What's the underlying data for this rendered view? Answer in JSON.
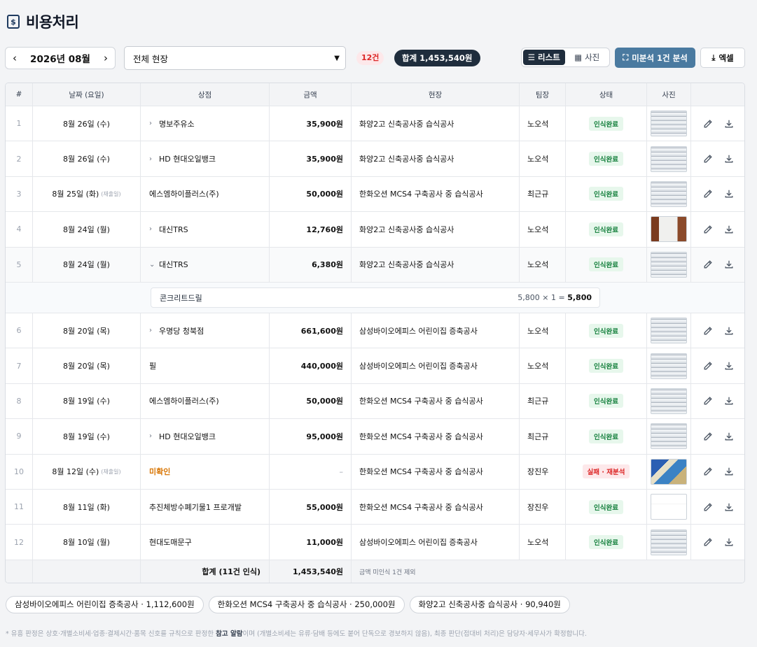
{
  "page": {
    "title": "비용처리",
    "title_icon": "receipt-dollar-icon"
  },
  "toolbar": {
    "prev_icon": "‹",
    "next_icon": "›",
    "month_label": "2026년 08월",
    "site_filter": "전체 현장",
    "count_badge": "12건",
    "total_badge": "합계 1,453,540원",
    "view_list_label": "리스트",
    "view_photo_label": "사진",
    "analyze_label": "미분석 1건 분석",
    "excel_label": "엑셀"
  },
  "table": {
    "headers": {
      "no": "#",
      "date": "날짜 (요일)",
      "store": "상점",
      "amount": "금액",
      "site": "현장",
      "lead": "팀장",
      "status": "상태",
      "photo": "사진"
    },
    "rows": [
      {
        "no": "1",
        "date": "8월 26일 (수)",
        "sub": "",
        "expand": "›",
        "store": "명보주유소",
        "amount": "35,900원",
        "site": "화양2고 신축공사중 습식공사",
        "lead": "노오석",
        "status": "인식완료",
        "status_type": "ok"
      },
      {
        "no": "2",
        "date": "8월 26일 (수)",
        "sub": "",
        "expand": "›",
        "store": "HD 현대오일뱅크",
        "amount": "35,900원",
        "site": "화양2고 신축공사중 습식공사",
        "lead": "노오석",
        "status": "인식완료",
        "status_type": "ok"
      },
      {
        "no": "3",
        "date": "8월 25일 (화)",
        "sub": "(재출일)",
        "expand": "",
        "store": "에스엠하이플러스(주)",
        "amount": "50,000원",
        "site": "한화오션 MCS4 구축공사 중 습식공사",
        "lead": "최근규",
        "status": "인식완료",
        "status_type": "ok"
      },
      {
        "no": "4",
        "date": "8월 24일 (월)",
        "sub": "",
        "expand": "›",
        "store": "대신TRS",
        "amount": "12,760원",
        "site": "화양2고 신축공사중 습식공사",
        "lead": "노오석",
        "status": "인식완료",
        "status_type": "ok"
      },
      {
        "no": "5",
        "date": "8월 24일 (월)",
        "sub": "",
        "expand": "⌄",
        "store": "대신TRS",
        "amount": "6,380원",
        "site": "화양2고 신축공사중 습식공사",
        "lead": "노오석",
        "status": "인식완료",
        "status_type": "ok"
      },
      {
        "no": "6",
        "date": "8월 20일 (목)",
        "sub": "",
        "expand": "›",
        "store": "우명당 청북점",
        "amount": "661,600원",
        "site": "삼성바이오에피스 어린이집 증축공사",
        "lead": "노오석",
        "status": "인식완료",
        "status_type": "ok"
      },
      {
        "no": "7",
        "date": "8월 20일 (목)",
        "sub": "",
        "expand": "",
        "store": "필",
        "amount": "440,000원",
        "site": "삼성바이오에피스 어린이집 증축공사",
        "lead": "노오석",
        "status": "인식완료",
        "status_type": "ok"
      },
      {
        "no": "8",
        "date": "8월 19일 (수)",
        "sub": "",
        "expand": "",
        "store": "에스엠하이플러스(주)",
        "amount": "50,000원",
        "site": "한화오션 MCS4 구축공사 중 습식공사",
        "lead": "최근규",
        "status": "인식완료",
        "status_type": "ok"
      },
      {
        "no": "9",
        "date": "8월 19일 (수)",
        "sub": "",
        "expand": "›",
        "store": "HD 현대오일뱅크",
        "amount": "95,000원",
        "site": "한화오션 MCS4 구축공사 중 습식공사",
        "lead": "최근규",
        "status": "인식완료",
        "status_type": "ok"
      },
      {
        "no": "10",
        "date": "8월 12일 (수)",
        "sub": "(재출일)",
        "expand": "",
        "store": "미확인",
        "amount": "–",
        "site": "한화오션 MCS4 구축공사 중 습식공사",
        "lead": "장진우",
        "status": "실패 · 재분석",
        "status_type": "fail"
      },
      {
        "no": "11",
        "date": "8월 11일 (화)",
        "sub": "",
        "expand": "",
        "store": "추진체방수폐기물1 프로개발",
        "amount": "55,000원",
        "site": "한화오션 MCS4 구축공사 중 습식공사",
        "lead": "장진우",
        "status": "인식완료",
        "status_type": "ok"
      },
      {
        "no": "12",
        "date": "8월 10일 (월)",
        "sub": "",
        "expand": "",
        "store": "현대도매문구",
        "amount": "11,000원",
        "site": "삼성바이오에피스 어린이집 증축공사",
        "lead": "노오석",
        "status": "인식완료",
        "status_type": "ok"
      }
    ],
    "detail": {
      "item": "콘크리트드릴",
      "calc": "5,800 × 1 = ",
      "result": "5,800"
    },
    "total": {
      "label": "합계 (11건 인식)",
      "amount": "1,453,540원",
      "note": "금액 미인식 1건 제외"
    }
  },
  "summary_chips": [
    "삼성바이오에피스 어린이집 증축공사 · 1,112,600원",
    "한화오션 MCS4 구축공사 중 습식공사 · 250,000원",
    "화양2고 신축공사중 습식공사 · 90,940원"
  ],
  "footnote": {
    "prefix": "* 유흥 판정은 상호·개별소비세·업종·결제시간·품목 신호를 규칙으로 판정한 ",
    "bold": "참고 알람",
    "suffix": "이며 (개별소비세는 유류·담배 등에도 붙어 단독으로 경보하지 않음), 최종 판단(접대비 처리)은 담당자·세무사가 확정합니다."
  },
  "colors": {
    "dark": "#1f2d3d",
    "accent": "#4a7aa0",
    "ok_bg": "#e7f7ec",
    "ok_text": "#15803d",
    "fail_bg": "#fde8ea",
    "fail_text": "#dc2626",
    "pending": "#d97706"
  }
}
